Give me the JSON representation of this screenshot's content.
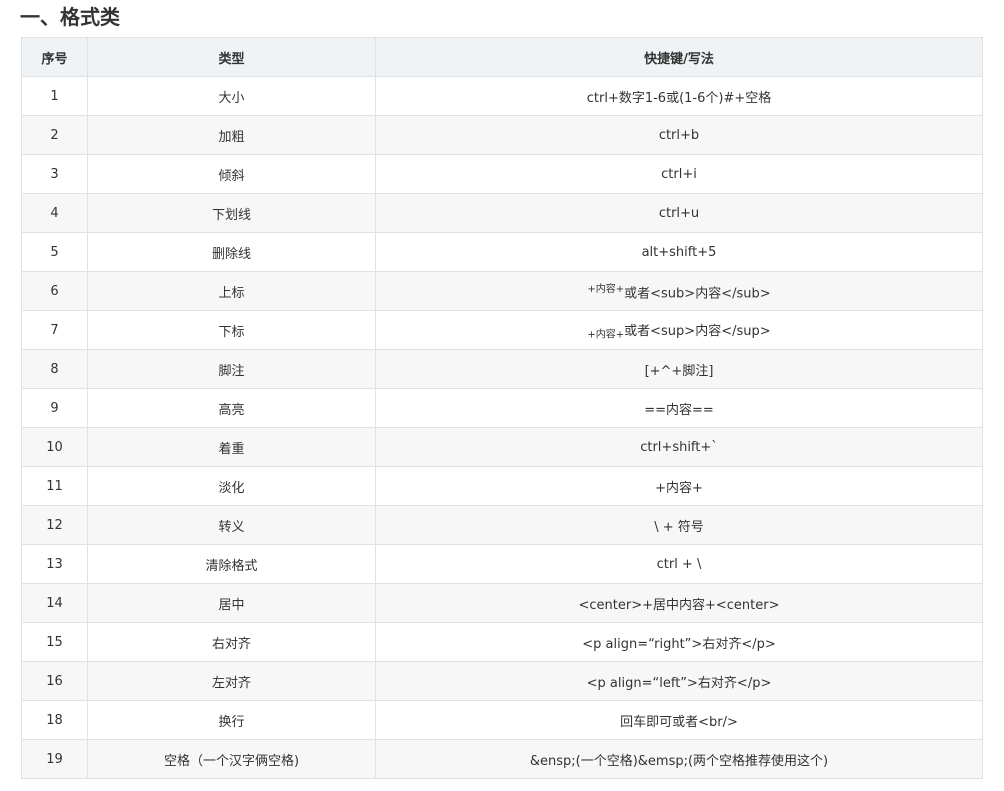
{
  "section": {
    "title": "一、格式类"
  },
  "table": {
    "headers": [
      "序号",
      "类型",
      "快捷键/写法"
    ],
    "rows": [
      {
        "no": "1",
        "type": "大小",
        "shortcut": "ctrl+数字1-6或(1-6个)#+空格"
      },
      {
        "no": "2",
        "type": "加粗",
        "shortcut": "ctrl+b"
      },
      {
        "no": "3",
        "type": "倾斜",
        "shortcut": "ctrl+i"
      },
      {
        "no": "4",
        "type": "下划线",
        "shortcut": "ctrl+u"
      },
      {
        "no": "5",
        "type": "删除线",
        "shortcut": "alt+shift+5"
      },
      {
        "no": "6",
        "type": "上标",
        "shortcut_small": "+内容+",
        "shortcut_rest": "或者<sub>内容</sub>"
      },
      {
        "no": "7",
        "type": "下标",
        "shortcut_small": "+内容+",
        "shortcut_rest": "或者<sup>内容</sup>"
      },
      {
        "no": "8",
        "type": "脚注",
        "shortcut": "[+^+脚注]"
      },
      {
        "no": "9",
        "type": "高亮",
        "shortcut": "==内容=="
      },
      {
        "no": "10",
        "type": "着重",
        "shortcut": "ctrl+shift+`"
      },
      {
        "no": "11",
        "type": "淡化",
        "shortcut": "+内容+"
      },
      {
        "no": "12",
        "type": "转义",
        "shortcut": "\\ + 符号"
      },
      {
        "no": "13",
        "type": "清除格式",
        "shortcut": "ctrl + \\"
      },
      {
        "no": "14",
        "type": "居中",
        "shortcut": "<center>+居中内容+<center>"
      },
      {
        "no": "15",
        "type": "右对齐",
        "shortcut": "<p align=“right”>右对齐</p>"
      },
      {
        "no": "16",
        "type": "左对齐",
        "shortcut": "<p align=“left”>右对齐</p>"
      },
      {
        "no": "18",
        "type": "换行",
        "shortcut": "回车即可或者<br/>"
      },
      {
        "no": "19",
        "type": "空格（一个汉字俩空格)",
        "shortcut": "&ensp;(一个空格)&emsp;(两个空格推荐使用这个)"
      }
    ]
  }
}
